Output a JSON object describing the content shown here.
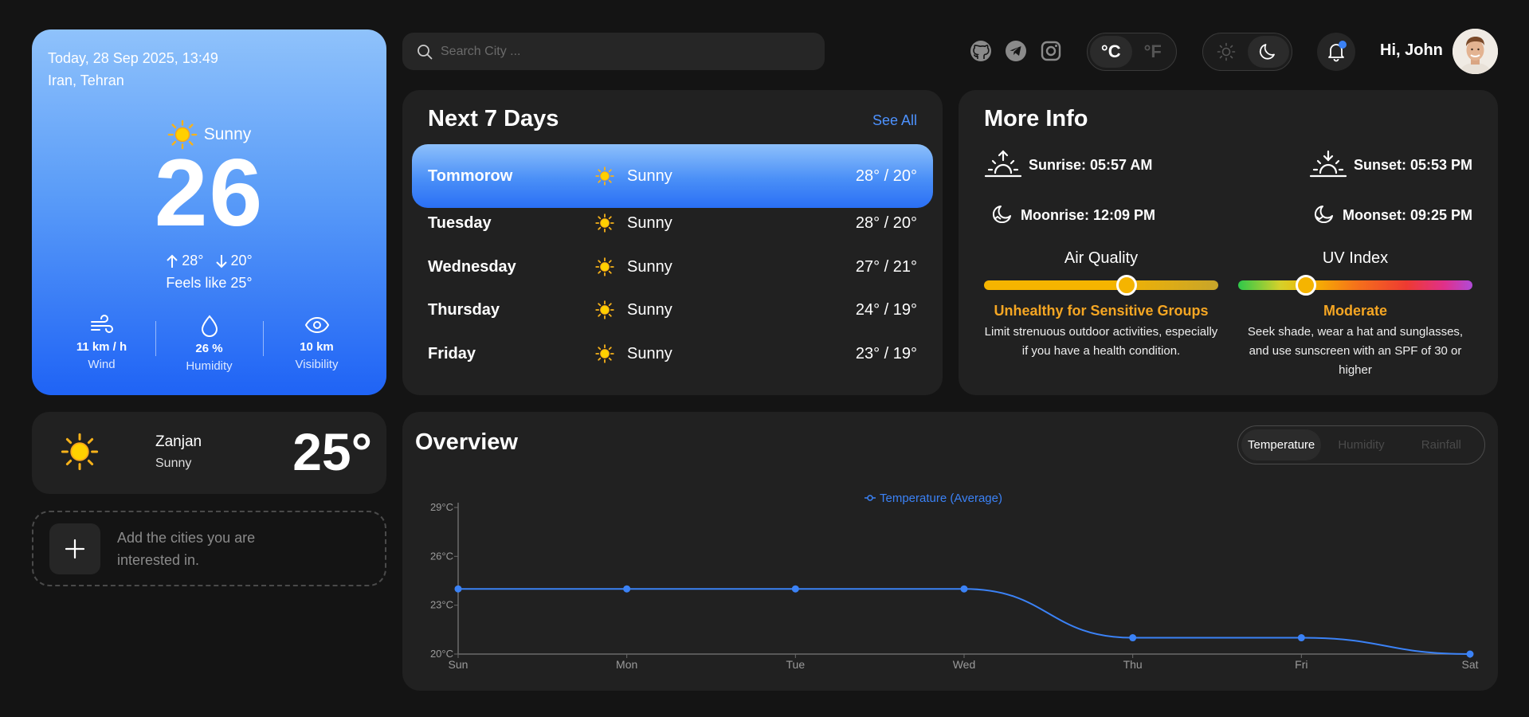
{
  "current": {
    "date": "Today, 28 Sep 2025, 13:49",
    "location": "Iran, Tehran",
    "condition": "Sunny",
    "temp": "26",
    "high": "28°",
    "low": "20°",
    "feels_like": "Feels like 25°",
    "stats": [
      {
        "icon": "wind-icon",
        "value": "11 km / h",
        "label": "Wind"
      },
      {
        "icon": "droplet-icon",
        "value": "26 %",
        "label": "Humidity"
      },
      {
        "icon": "eye-icon",
        "value": "10 km",
        "label": "Visibility"
      }
    ]
  },
  "saved_city": {
    "name": "Zanjan",
    "condition": "Sunny",
    "temp": "25°"
  },
  "add_city": {
    "text": "Add the cities you are interested in."
  },
  "search": {
    "placeholder": "Search City ..."
  },
  "socials": [
    "github-icon",
    "telegram-icon",
    "instagram-icon"
  ],
  "units": {
    "celsius": "°C",
    "fahrenheit": "°F",
    "active": "celsius"
  },
  "theme": {
    "active": "dark"
  },
  "user": {
    "greeting": "Hi, John"
  },
  "forecast": {
    "title": "Next 7 Days",
    "see_all": "See All",
    "days": [
      {
        "day": "Tommorow",
        "condition": "Sunny",
        "range": "28° / 20°",
        "active": true
      },
      {
        "day": "Tuesday",
        "condition": "Sunny",
        "range": "28° / 20°"
      },
      {
        "day": "Wednesday",
        "condition": "Sunny",
        "range": "27° / 21°"
      },
      {
        "day": "Thursday",
        "condition": "Sunny",
        "range": "24° / 19°"
      },
      {
        "day": "Friday",
        "condition": "Sunny",
        "range": "23° / 19°"
      }
    ]
  },
  "more_info": {
    "title": "More Info",
    "sunrise": "Sunrise: 05:57 AM",
    "sunset": "Sunset: 05:53 PM",
    "moonrise": "Moonrise: 12:09 PM",
    "moonset": "Moonset: 09:25 PM",
    "air_quality": {
      "title": "Air Quality",
      "status": "Unhealthy for Sensitive Groups",
      "description": "Limit strenuous outdoor activities, especially if you have a health condition.",
      "level": 0.61
    },
    "uv_index": {
      "title": "UV Index",
      "status": "Moderate",
      "description": "Seek shade, wear a hat and sunglasses, and use sunscreen with an SPF of 30 or higher",
      "level": 0.29
    }
  },
  "overview": {
    "title": "Overview",
    "tabs": [
      "Temperature",
      "Humidity",
      "Rainfall"
    ],
    "active_tab": "Temperature"
  },
  "colors": {
    "accent": "#3b82f6",
    "warning": "#f5a623",
    "card": "#212121",
    "background": "#141414"
  },
  "chart_data": {
    "type": "line",
    "categories": [
      "Sun",
      "Mon",
      "Tue",
      "Wed",
      "Thu",
      "Fri",
      "Sat"
    ],
    "series": [
      {
        "name": "Temperature (Average)",
        "values": [
          24,
          24,
          24,
          24,
          21,
          21,
          20
        ]
      }
    ],
    "ylim": [
      20,
      29
    ],
    "yticks": [
      "20°C",
      "23°C",
      "26°C",
      "29°C"
    ],
    "ytick_values": [
      20,
      23,
      26,
      29
    ],
    "legend": "top-center",
    "grid": false
  }
}
